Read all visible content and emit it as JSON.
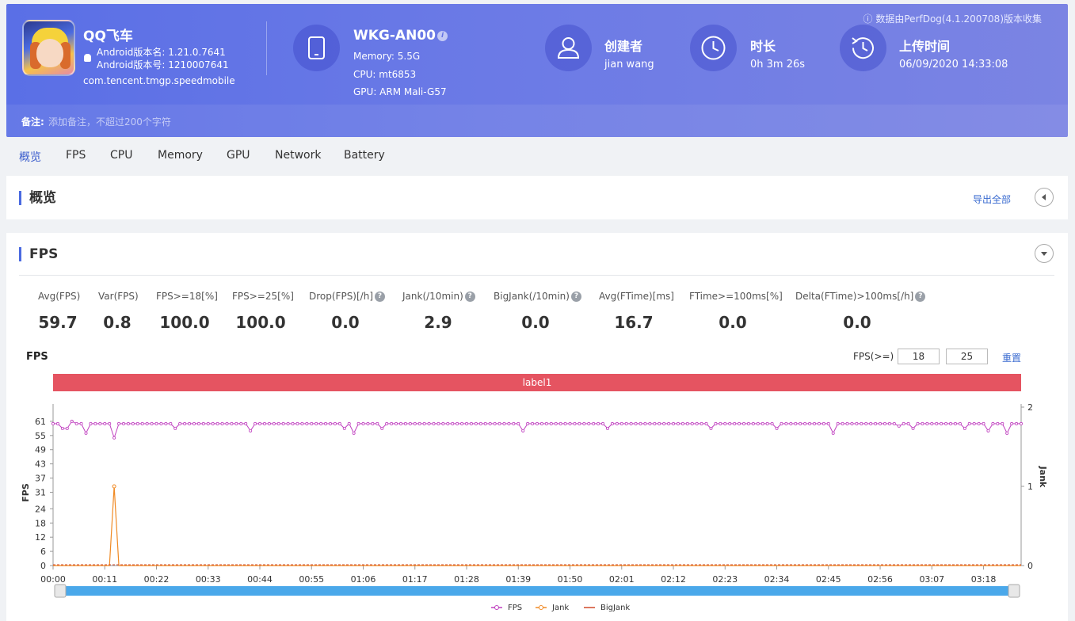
{
  "header": {
    "app_name": "QQ飞车",
    "version_name": "Android版本名: 1.21.0.7641",
    "version_code": "Android版本号: 1210007641",
    "package": "com.tencent.tmgp.speedmobile",
    "device": {
      "model": "WKG-AN00",
      "memory": "Memory: 5.5G",
      "cpu": "CPU: mt6853",
      "gpu": "GPU: ARM Mali-G57"
    },
    "creator": {
      "title": "创建者",
      "value": "jian wang"
    },
    "duration": {
      "title": "时长",
      "value": "0h 3m 26s"
    },
    "upload": {
      "title": "上传时间",
      "value": "06/09/2020 14:33:08"
    },
    "source_note": "数据由PerfDog(4.1.200708)版本收集",
    "note_label": "备注:",
    "note_placeholder": "添加备注，不超过200个字符",
    "colors": {
      "gradient_start": "#5a6fe6",
      "gradient_end": "#7b84e3"
    }
  },
  "tabs": [
    "概览",
    "FPS",
    "CPU",
    "Memory",
    "GPU",
    "Network",
    "Battery"
  ],
  "active_tab": "概览",
  "overview": {
    "title": "概览",
    "export_label": "导出全部"
  },
  "fps_section": {
    "title": "FPS",
    "metrics": [
      {
        "label": "Avg(FPS)",
        "value": "59.7",
        "help": false
      },
      {
        "label": "Var(FPS)",
        "value": "0.8",
        "help": false
      },
      {
        "label": "FPS>=18[%]",
        "value": "100.0",
        "help": false
      },
      {
        "label": "FPS>=25[%]",
        "value": "100.0",
        "help": false
      },
      {
        "label": "Drop(FPS)[/h]",
        "value": "0.0",
        "help": true
      },
      {
        "label": "Jank(/10min)",
        "value": "2.9",
        "help": true
      },
      {
        "label": "BigJank(/10min)",
        "value": "0.0",
        "help": true
      },
      {
        "label": "Avg(FTime)[ms]",
        "value": "16.7",
        "help": false
      },
      {
        "label": "FTime>=100ms[%]",
        "value": "0.0",
        "help": false
      },
      {
        "label": "Delta(FTime)>100ms[/h]",
        "value": "0.0",
        "help": true
      }
    ],
    "chart_title": "FPS",
    "threshold_label": "FPS(>=)",
    "threshold_1": "18",
    "threshold_2": "25",
    "reset_label": "重置",
    "label_bar": "label1"
  },
  "chart_data": {
    "type": "line",
    "title": "FPS",
    "ylabel": "FPS",
    "y2label": "Jank",
    "yticks": [
      0,
      6,
      12,
      18,
      24,
      31,
      37,
      43,
      49,
      55,
      61
    ],
    "ylim": [
      0,
      67
    ],
    "y2ticks": [
      0,
      1,
      2
    ],
    "y2lim": [
      0,
      2
    ],
    "xticks": [
      "00:00",
      "00:11",
      "00:22",
      "00:33",
      "00:44",
      "00:55",
      "01:06",
      "01:17",
      "01:28",
      "01:39",
      "01:50",
      "02:01",
      "02:12",
      "02:23",
      "02:34",
      "02:45",
      "02:56",
      "03:07",
      "03:18"
    ],
    "duration_seconds": 206,
    "series": [
      {
        "name": "FPS",
        "color": "#c040c0",
        "axis": "left",
        "dips": [
          [
            2,
            58
          ],
          [
            3,
            58
          ],
          [
            4,
            61
          ],
          [
            5,
            60
          ],
          [
            7,
            56
          ],
          [
            13,
            54
          ],
          [
            14,
            60
          ],
          [
            26,
            58
          ],
          [
            42,
            57
          ],
          [
            62,
            58
          ],
          [
            64,
            56
          ],
          [
            70,
            58
          ],
          [
            100,
            57
          ],
          [
            118,
            58
          ],
          [
            140,
            58
          ],
          [
            154,
            58
          ],
          [
            166,
            56
          ],
          [
            180,
            59
          ],
          [
            183,
            58
          ],
          [
            194,
            58
          ],
          [
            199,
            57
          ],
          [
            203,
            56
          ],
          [
            205,
            60
          ]
        ],
        "base": 60
      },
      {
        "name": "Jank",
        "color": "#f08a24",
        "axis": "right",
        "points": [
          [
            0,
            0
          ],
          [
            12,
            0
          ],
          [
            13,
            1
          ],
          [
            14,
            0
          ],
          [
            206,
            0
          ]
        ]
      },
      {
        "name": "BigJank",
        "color": "#d04a2a",
        "axis": "right",
        "points": [
          [
            0,
            0
          ],
          [
            206,
            0
          ]
        ]
      }
    ],
    "legend_position": "bottom"
  }
}
